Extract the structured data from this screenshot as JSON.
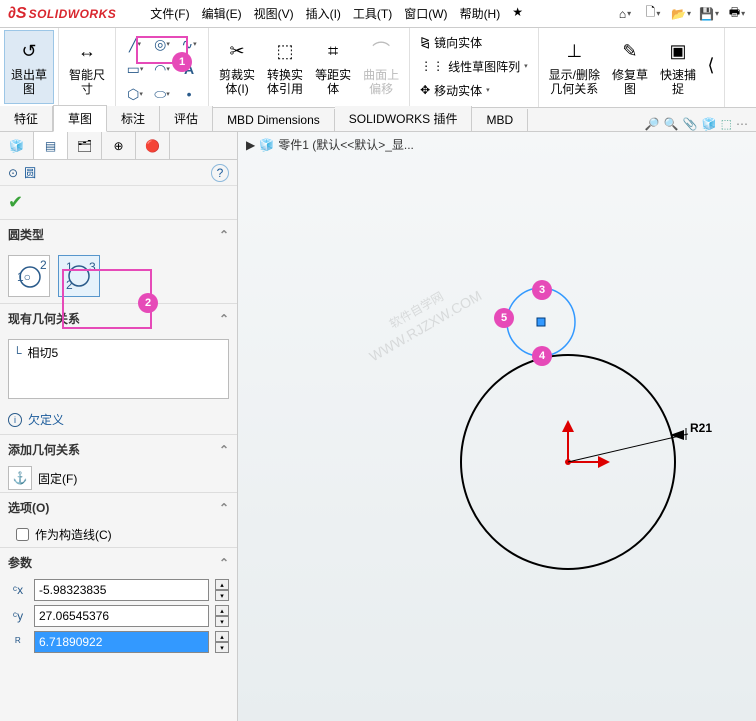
{
  "app": {
    "name": "SOLIDWORKS"
  },
  "menu": {
    "file": "文件(F)",
    "edit": "编辑(E)",
    "view": "视图(V)",
    "insert": "插入(I)",
    "tools": "工具(T)",
    "window": "窗口(W)",
    "help": "帮助(H)"
  },
  "ribbon": {
    "exit_sketch": "退出草\n图",
    "smart_dim": "智能尺\n寸",
    "trim": "剪裁实\n体(I)",
    "convert": "转换实\n体引用",
    "offset": "等距实\n体",
    "surface_offset": "曲面上\n偏移",
    "mirror": "镜向实体",
    "linear_pattern": "线性草图阵列",
    "move": "移动实体",
    "show_del_rel": "显示/删除\n几何关系",
    "repair": "修复草\n图",
    "quick_snap": "快速捕\n捉"
  },
  "tabs": {
    "features": "特征",
    "sketch": "草图",
    "annot": "标注",
    "eval": "评估",
    "mbd_dim": "MBD Dimensions",
    "sw_addin": "SOLIDWORKS 插件",
    "mbd": "MBD"
  },
  "breadcrumb": "零件1 (默认<<默认>_显...",
  "prop": {
    "title": "圆",
    "sec_type": "圆类型",
    "sec_existing": "现有几何关系",
    "rel1": "相切5",
    "underdef": "欠定义",
    "sec_add": "添加几何关系",
    "fix": "固定(F)",
    "sec_opt": "选项(O)",
    "construct": "作为构造线(C)",
    "sec_param": "参数",
    "cx": "-5.98323835",
    "cy": "27.06545376",
    "r": "6.71890922"
  },
  "dim_label": "R21",
  "watermark_l1": "软件自学网",
  "watermark_l2": "WWW.RJZXW.COM",
  "annots": {
    "a1": "1",
    "a2": "2",
    "a3": "3",
    "a4": "4",
    "a5": "5"
  }
}
